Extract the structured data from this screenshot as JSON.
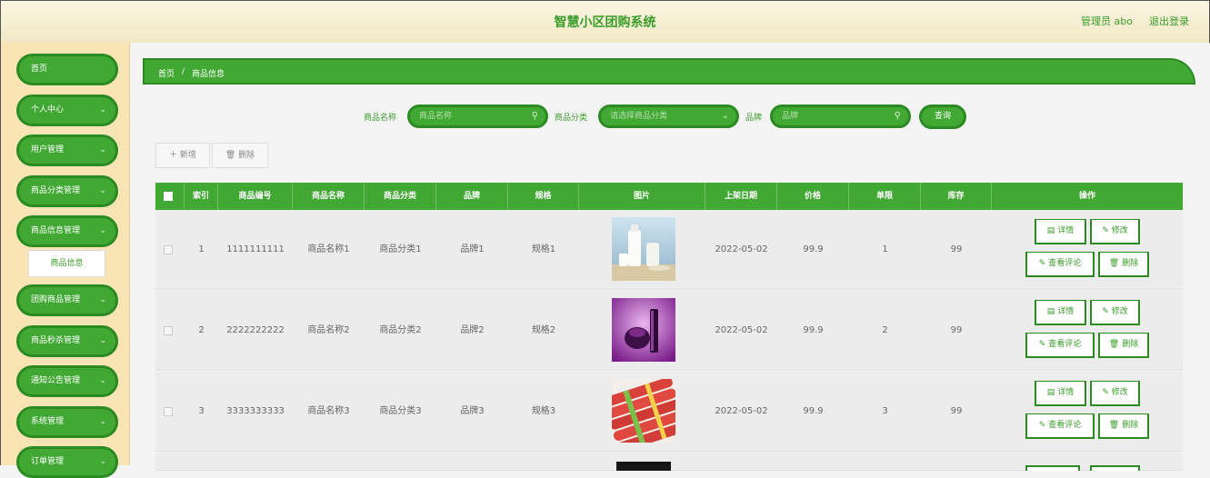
{
  "header": {
    "title": "智慧小区团购系统",
    "user": "管理员 abo",
    "logout": "退出登录"
  },
  "sidebar": {
    "items": [
      {
        "label": "首页",
        "chevron": ""
      },
      {
        "label": "个人中心",
        "chevron": "⌄"
      },
      {
        "label": "用户管理",
        "chevron": "⌄"
      },
      {
        "label": "商品分类管理",
        "chevron": "⌄"
      },
      {
        "label": "商品信息管理",
        "chevron": "⌄"
      },
      {
        "label": "团购商品管理",
        "chevron": "⌄"
      },
      {
        "label": "商品秒杀管理",
        "chevron": "⌄"
      },
      {
        "label": "通知公告管理",
        "chevron": "⌄"
      },
      {
        "label": "系统管理",
        "chevron": "⌄"
      },
      {
        "label": "订单管理",
        "chevron": "⌄"
      }
    ],
    "submenu": {
      "label": "商品信息"
    }
  },
  "breadcrumb": {
    "home": "首页",
    "sep": "/",
    "current": "商品信息"
  },
  "search": {
    "name_label": "商品名称",
    "name_placeholder": "商品名称",
    "category_label": "商品分类",
    "category_placeholder": "请选择商品分类",
    "brand_label": "品牌",
    "brand_placeholder": "品牌",
    "query_button": "查询"
  },
  "toolbar": {
    "add": "＋ 新增",
    "delete": "🗑 删除"
  },
  "table": {
    "headers": [
      "索引",
      "商品编号",
      "商品名称",
      "商品分类",
      "品牌",
      "规格",
      "图片",
      "上架日期",
      "价格",
      "单限",
      "库存",
      "操作"
    ],
    "rows": [
      {
        "index": "1",
        "code": "1111111111",
        "name": "商品名称1",
        "category": "商品分类1",
        "brand": "品牌1",
        "spec": "规格1",
        "date": "2022-05-02",
        "price": "99.9",
        "limit": "1",
        "stock": "99",
        "image": "milk"
      },
      {
        "index": "2",
        "code": "2222222222",
        "name": "商品名称2",
        "category": "商品分类2",
        "brand": "品牌2",
        "spec": "规格2",
        "date": "2022-05-02",
        "price": "99.9",
        "limit": "2",
        "stock": "99",
        "image": "cosmetics"
      },
      {
        "index": "3",
        "code": "3333333333",
        "name": "商品名称3",
        "category": "商品分类3",
        "brand": "品牌3",
        "spec": "规格3",
        "date": "2022-05-02",
        "price": "99.9",
        "limit": "3",
        "stock": "99",
        "image": "sausage"
      }
    ],
    "actions": {
      "detail": "详情",
      "edit": "修改",
      "comments": "查看评论",
      "delete": "删除"
    }
  },
  "colors": {
    "accent": "#41a834",
    "accent_dark": "#2c8a22",
    "header_bg": "#f6eed2",
    "sidebar_bg": "#f9e4b6"
  }
}
